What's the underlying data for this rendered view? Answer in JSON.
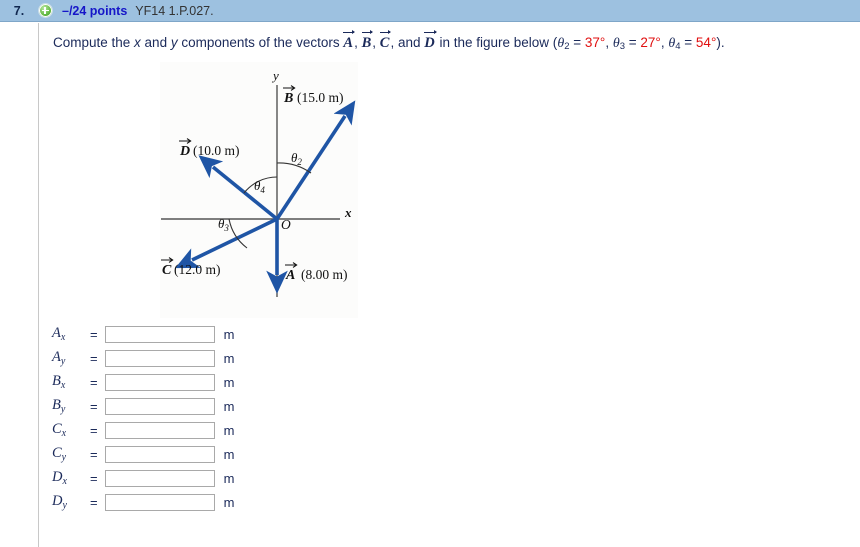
{
  "header": {
    "question_number": "7.",
    "expand_icon": "plus-circle-icon",
    "points": "–/24 points",
    "code": "YF14 1.P.027."
  },
  "prompt": {
    "part1": "Compute the ",
    "x": "x",
    "part2": " and ",
    "y": "y",
    "part3": " components of the vectors ",
    "vec_a": "A",
    "sep1": ", ",
    "vec_b": "B",
    "sep2": ", ",
    "vec_c": "C",
    "sep3": ", and ",
    "vec_d": "D",
    "part4": " in the figure below (",
    "theta2_sym": "θ",
    "theta2_sub": "2",
    "eq1": " = ",
    "theta2_val": "37°",
    "comma1": ", ",
    "theta3_sym": "θ",
    "theta3_sub": "3",
    "eq2": " = ",
    "theta3_val": "27°",
    "comma2": ", ",
    "theta4_sym": "θ",
    "theta4_sub": "4",
    "eq3": " = ",
    "theta4_val": "54°",
    "part5": ")."
  },
  "figure": {
    "axis_label_x": "x",
    "axis_label_y": "y",
    "origin_label": "O",
    "vector_color": "#1f55a5",
    "axis_color": "#555555",
    "labels": {
      "a": {
        "vec": "A",
        "mag": "(8.00 m)"
      },
      "b": {
        "vec": "B",
        "mag": "(15.0 m)"
      },
      "c": {
        "vec": "C",
        "mag": "(12.0 m)"
      },
      "d": {
        "vec": "D",
        "mag": "(10.0 m)"
      }
    },
    "angles": {
      "theta2": {
        "sym": "θ",
        "sub": "2"
      },
      "theta3": {
        "sym": "θ",
        "sub": "3"
      },
      "theta4": {
        "sym": "θ",
        "sub": "4"
      }
    }
  },
  "answers": {
    "unit": "m",
    "equals": "=",
    "placeholder": "",
    "rows": [
      {
        "base": "A",
        "sub": "x",
        "value": ""
      },
      {
        "base": "A",
        "sub": "y",
        "value": ""
      },
      {
        "base": "B",
        "sub": "x",
        "value": ""
      },
      {
        "base": "B",
        "sub": "y",
        "value": ""
      },
      {
        "base": "C",
        "sub": "x",
        "value": ""
      },
      {
        "base": "C",
        "sub": "y",
        "value": ""
      },
      {
        "base": "D",
        "sub": "x",
        "value": ""
      },
      {
        "base": "D",
        "sub": "y",
        "value": ""
      }
    ]
  }
}
